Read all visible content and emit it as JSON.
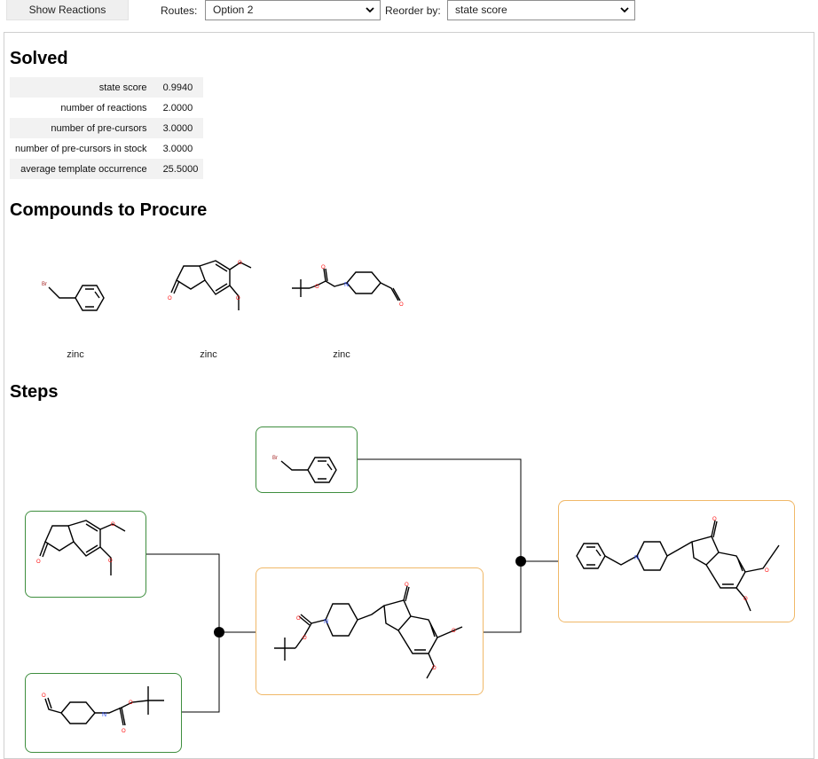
{
  "toolbar": {
    "show_reactions_label": "Show Reactions",
    "routes_label": "Routes:",
    "routes_value": "Option 2",
    "reorder_label": "Reorder by:",
    "reorder_value": "state score"
  },
  "solved": {
    "heading": "Solved",
    "stats": [
      {
        "key": "state score",
        "value": "0.9940"
      },
      {
        "key": "number of reactions",
        "value": "2.0000"
      },
      {
        "key": "number of pre-cursors",
        "value": "3.0000"
      },
      {
        "key": "number of pre-cursors in stock",
        "value": "3.0000"
      },
      {
        "key": "average template occurrence",
        "value": "25.5000"
      }
    ]
  },
  "compounds": {
    "heading": "Compounds to Procure",
    "items": [
      {
        "source": "zinc",
        "molecule": "benzyl-bromide"
      },
      {
        "source": "zinc",
        "molecule": "dimethoxy-indanone"
      },
      {
        "source": "zinc",
        "molecule": "boc-piperidine-aldehyde"
      }
    ]
  },
  "steps": {
    "heading": "Steps"
  },
  "atom_labels": {
    "br": "Br",
    "o": "O",
    "n": "N"
  },
  "colors": {
    "stock_border": "#3e8e3e",
    "intermediate_border": "#f0b868",
    "oxygen": "#ff0d0d",
    "nitrogen": "#3050f8",
    "bromine": "#a62929"
  }
}
